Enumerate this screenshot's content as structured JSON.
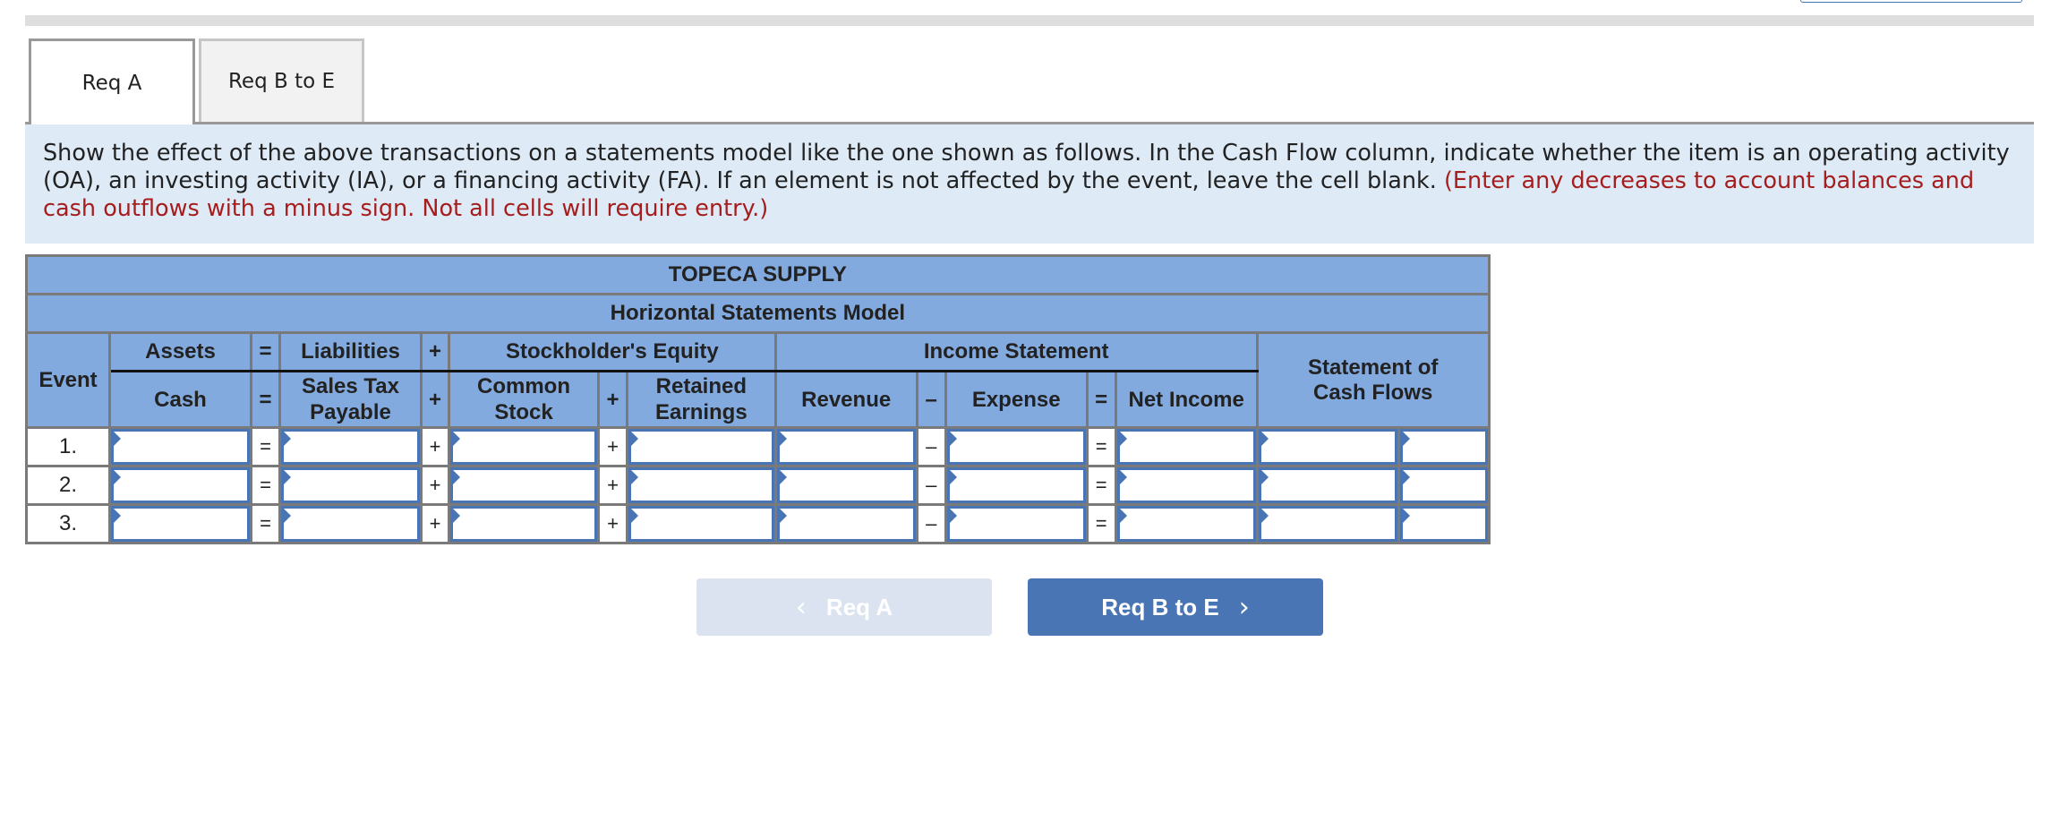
{
  "tabs": [
    {
      "label": "Req A",
      "active": true
    },
    {
      "label": "Req B to E",
      "active": false
    }
  ],
  "instructions": {
    "text": "Show the effect of the above transactions on a statements model like the one shown as follows. In the Cash Flow column, indicate whether the item is an operating activity (OA), an investing activity (IA), or a financing activity (FA). If an element is not affected by the event, leave the cell blank.",
    "note": "(Enter any decreases to account balances and cash outflows with a minus sign. Not all cells will require entry.)",
    "note_color": "#a51d1d"
  },
  "table": {
    "company": "TOPECA SUPPLY",
    "subtitle": "Horizontal Statements Model",
    "headers": {
      "event": "Event",
      "assets": "Assets",
      "eq1": "=",
      "liabilities": "Liabilities",
      "plus1": "+",
      "equity": "Stockholder's Equity",
      "income_statement": "Income Statement",
      "cash_flows": "Statement of Cash Flows",
      "cash": "Cash",
      "eq2": "=",
      "sales_tax_payable": "Sales Tax Payable",
      "plus2": "+",
      "common_stock": "Common Stock",
      "plus3": "+",
      "retained_earnings": "Retained Earnings",
      "revenue": "Revenue",
      "minus": "–",
      "expense": "Expense",
      "eq3": "=",
      "net_income": "Net Income"
    },
    "rows": [
      {
        "event": "1.",
        "ops": [
          "=",
          "+",
          "+",
          "–",
          "="
        ],
        "values": [
          "",
          "",
          "",
          "",
          "",
          "",
          "",
          "",
          ""
        ]
      },
      {
        "event": "2.",
        "ops": [
          "=",
          "+",
          "+",
          "–",
          "="
        ],
        "values": [
          "",
          "",
          "",
          "",
          "",
          "",
          "",
          "",
          ""
        ]
      },
      {
        "event": "3.",
        "ops": [
          "=",
          "+",
          "+",
          "–",
          "="
        ],
        "values": [
          "",
          "",
          "",
          "",
          "",
          "",
          "",
          "",
          ""
        ]
      }
    ]
  },
  "nav": {
    "prev_label": "Req A",
    "next_label": "Req B to E",
    "prev_icon": "chevron-left-icon",
    "next_icon": "chevron-right-icon"
  },
  "colors": {
    "header_blue": "#82aadf",
    "accent_blue": "#4a75b5",
    "panel_bg": "#deebf7"
  }
}
